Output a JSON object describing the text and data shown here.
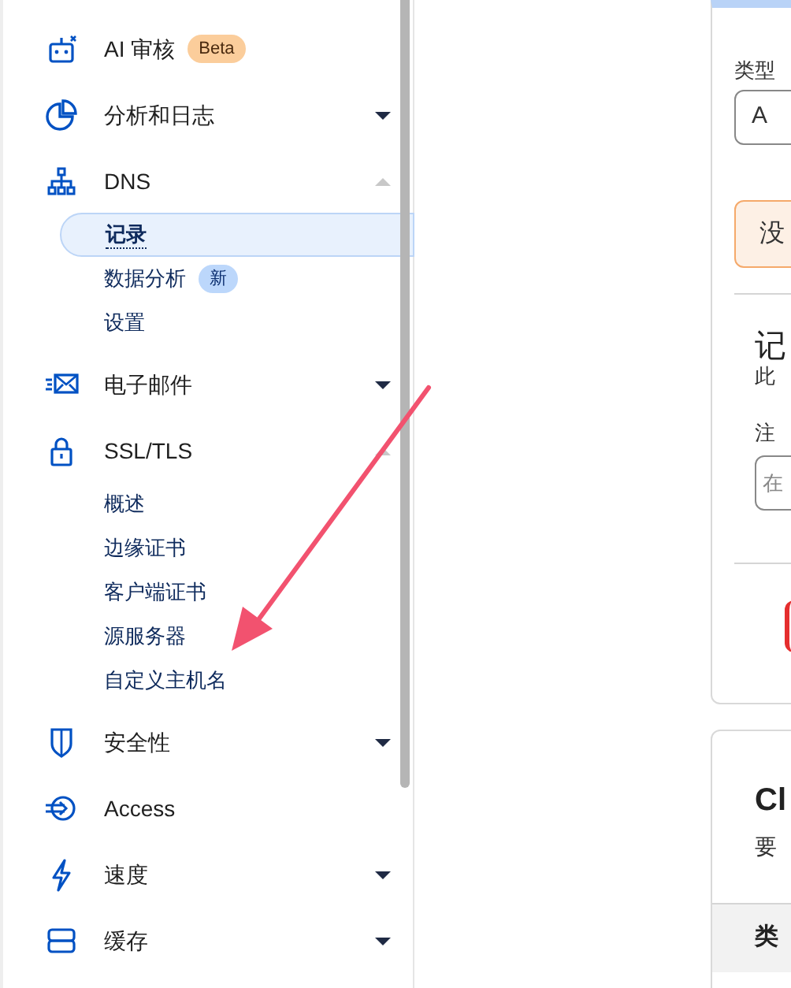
{
  "sidebar": {
    "items": [
      {
        "label": "AI 审核",
        "badge": {
          "text": "Beta",
          "kind": "beta"
        }
      },
      {
        "label": "分析和日志",
        "expanded": false
      },
      {
        "label": "DNS",
        "expanded": true,
        "children": [
          {
            "label": "记录",
            "selected": true
          },
          {
            "label": "数据分析",
            "selected": false,
            "badge": {
              "text": "新",
              "kind": "new"
            }
          },
          {
            "label": "设置",
            "selected": false
          }
        ]
      },
      {
        "label": "电子邮件",
        "expanded": false
      },
      {
        "label": "SSL/TLS",
        "expanded": true,
        "children": [
          {
            "label": "概述",
            "selected": false
          },
          {
            "label": "边缘证书",
            "selected": false
          },
          {
            "label": "客户端证书",
            "selected": false
          },
          {
            "label": "源服务器",
            "selected": false
          },
          {
            "label": "自定义主机名",
            "selected": false
          }
        ]
      },
      {
        "label": "安全性",
        "expanded": false
      },
      {
        "label": "Access"
      },
      {
        "label": "速度",
        "expanded": false
      },
      {
        "label": "缓存",
        "expanded": false
      }
    ]
  },
  "record_card": {
    "type_label": "类型",
    "type_value": "A",
    "alert": "没",
    "section_title": "记",
    "section_text": "此",
    "comment_label": "注",
    "comment_placeholder": "在"
  },
  "second_card": {
    "title": "Cl",
    "text": "要",
    "table_header": "类"
  }
}
